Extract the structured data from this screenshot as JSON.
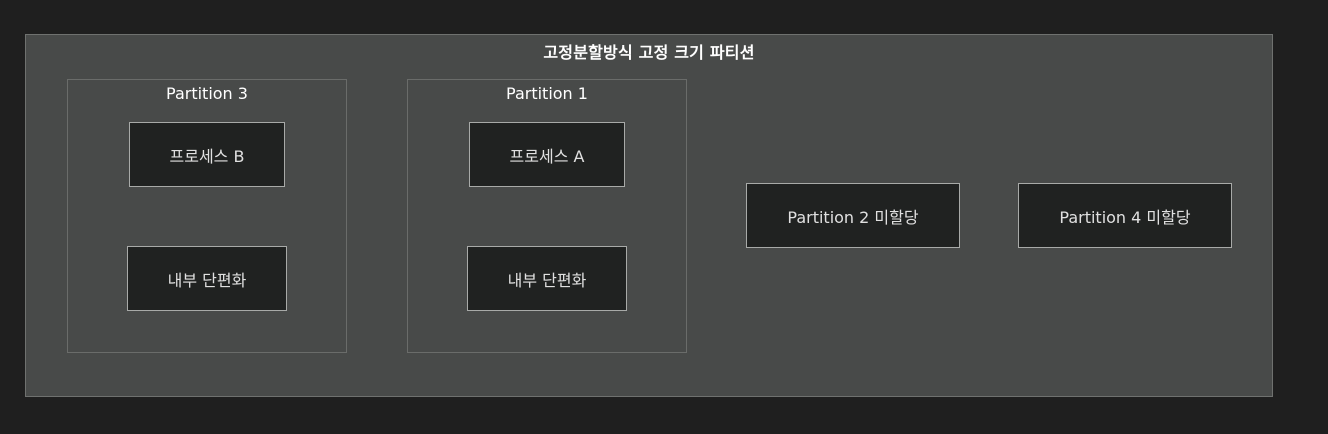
{
  "diagram": {
    "title": "고정분할방식 고정 크기 파티션",
    "partitions": [
      {
        "title": "Partition 3",
        "process": "프로세스 B",
        "fragment": "내부 단편화"
      },
      {
        "title": "Partition 1",
        "process": "프로세스 A",
        "fragment": "내부 단편화"
      }
    ],
    "unallocated": [
      "Partition 2 미할당",
      "Partition 4 미할당"
    ]
  },
  "colors": {
    "background": "#1f1f1f",
    "group_fill": "#484a49",
    "node_fill": "#202221",
    "node_border": "#a8aaa8",
    "text": "#ffffff"
  }
}
